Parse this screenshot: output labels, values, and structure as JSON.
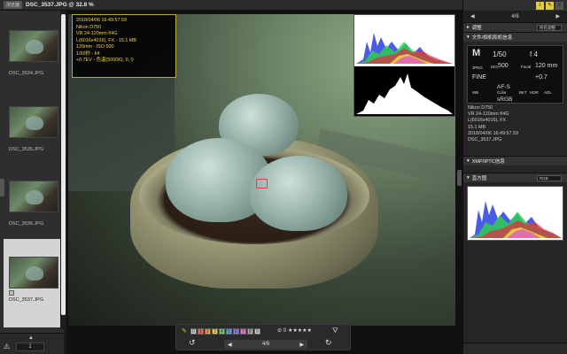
{
  "window": {
    "mode_label": "浏览器",
    "title": "DSC_3537.JPG @ 32.8 %"
  },
  "film_strip": {
    "items": [
      {
        "name": "DSC_3534.JPG",
        "selected": false
      },
      {
        "name": "DSC_3535.JPG",
        "selected": false
      },
      {
        "name": "DSC_3536.JPG",
        "selected": false
      },
      {
        "name": "DSC_3537.JPG",
        "selected": true
      }
    ],
    "page_value": "1"
  },
  "info_overlay": {
    "lines": [
      "2018/04/06 16:49:57.59",
      "Nikon D750",
      "VR 24-120mm f/4G",
      "L(6016x4016), FX - 15.1 MB",
      "120mm - ISO 500",
      "1/50秒 - f/4",
      "+0.7EV - 色温(5000K), 0, 0"
    ]
  },
  "bottom_toolbar": {
    "labels": [
      "0",
      "1",
      "2",
      "3",
      "4",
      "5",
      "6",
      "7",
      "8",
      "9"
    ],
    "label_colors": [
      "#cfcfcf",
      "#e06a6a",
      "#e8a04c",
      "#e7d65a",
      "#7ec36f",
      "#6aa6e0",
      "#9a7ce0",
      "#e07ac8",
      "#b0b0b0",
      "#d0d0d0"
    ],
    "rating_label": "⊘ 0",
    "stars": "★★★★★",
    "counter": "4/6"
  },
  "right_panel": {
    "counter": "4/6",
    "adjust": {
      "title": "调整",
      "select_value": "所有调整"
    },
    "camera_section": {
      "title": "文件/相机和机信息",
      "mode": "M",
      "shutter": "1/50",
      "aperture": "f 4",
      "iso_label": "ISO",
      "iso": "500",
      "focal_label": "Focal",
      "focal": "120 mm",
      "fine": "FINE",
      "ev": "+0.7",
      "wb": "WB",
      "af": "AF-S",
      "color": "Color",
      "srgb": "sRGB",
      "hdr": "HDR",
      "bkt": "BKT",
      "adl": "ADL",
      "jpeg_label": "JPEG"
    },
    "meta_lines": [
      "Nikon D750",
      "VR 24-120mm f/4G",
      "L(6016x4016), FX",
      "15.1 MB",
      "2018/04/06 16:49:57.59",
      "DSC_3537.JPG"
    ],
    "xmp_title": "XMP/IPTC信息",
    "histogram_title": "直方图",
    "histogram_select": "RGB"
  }
}
